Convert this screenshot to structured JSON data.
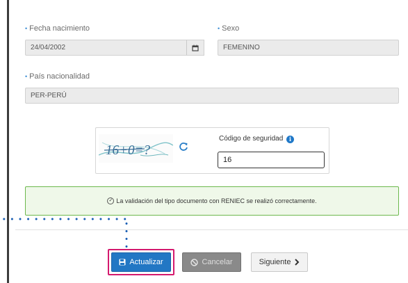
{
  "form": {
    "birth_date": {
      "label": "Fecha nacimiento",
      "value": "24/04/2002"
    },
    "sex": {
      "label": "Sexo",
      "value": "FEMENINO"
    },
    "nationality": {
      "label": "País nacionalidad",
      "value": "PER-PERÚ"
    },
    "captcha": {
      "text": "16+0=?",
      "label": "Código de seguridad",
      "value": "16"
    },
    "success_message": "La validación del tipo documento con RENIEC se realizó correctamente."
  },
  "actions": {
    "update_label": "Actualizar",
    "cancel_label": "Cancelar",
    "next_label": "Siguiente"
  },
  "colors": {
    "primary": "#2277c4",
    "highlight": "#d4196e",
    "success_border": "#6cb84d",
    "annotation_dots": "#1a5fb4"
  }
}
